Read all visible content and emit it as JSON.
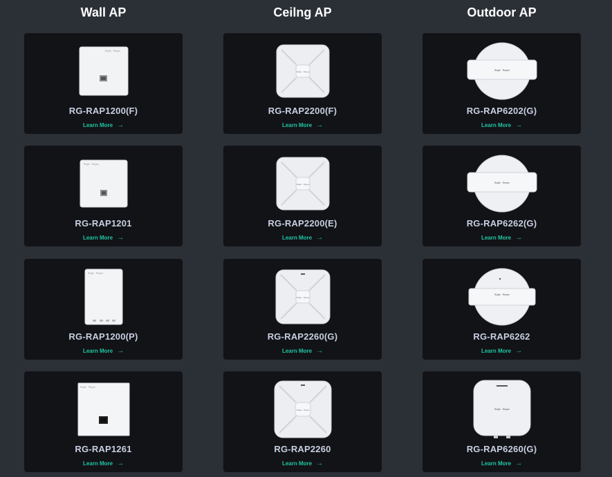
{
  "columns": [
    {
      "title": "Wall AP",
      "items": [
        {
          "name": "RG-RAP1200(F)",
          "link": "Learn More",
          "kind": "wall-square"
        },
        {
          "name": "RG-RAP1201",
          "link": "Learn More",
          "kind": "wall-small"
        },
        {
          "name": "RG-RAP1200(P)",
          "link": "Learn More",
          "kind": "wall-tall"
        },
        {
          "name": "RG-RAP1261",
          "link": "Learn More",
          "kind": "wall-flat"
        }
      ]
    },
    {
      "title": "Ceilng AP",
      "items": [
        {
          "name": "RG-RAP2200(F)",
          "link": "Learn More",
          "kind": "ceiling"
        },
        {
          "name": "RG-RAP2200(E)",
          "link": "Learn More",
          "kind": "ceiling"
        },
        {
          "name": "RG-RAP2260(G)",
          "link": "Learn More",
          "kind": "ceiling"
        },
        {
          "name": "RG-RAP2260",
          "link": "Learn More",
          "kind": "ceiling-large"
        }
      ]
    },
    {
      "title": "Outdoor AP",
      "items": [
        {
          "name": "RG-RAP6202(G)",
          "link": "Learn More",
          "kind": "outdoor-dome"
        },
        {
          "name": "RG-RAP6262(G)",
          "link": "Learn More",
          "kind": "outdoor-dome"
        },
        {
          "name": "RG-RAP6262",
          "link": "Learn More",
          "kind": "outdoor-dome-band"
        },
        {
          "name": "RG-RAP6260(G)",
          "link": "Learn More",
          "kind": "outdoor-square"
        }
      ]
    }
  ],
  "arrow_glyph": "→"
}
